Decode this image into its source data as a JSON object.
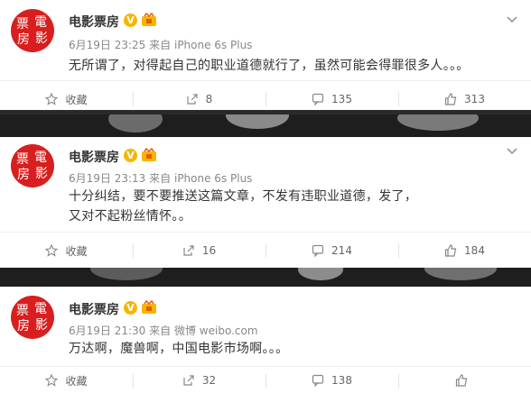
{
  "posts": [
    {
      "author": "电影票房",
      "avatar_chars": [
        "票",
        "電",
        "房",
        "影"
      ],
      "time": "6月19日 23:25",
      "source_prefix": "来自",
      "source": "iPhone 6s Plus",
      "content": "无所谓了，对得起自己的职业道德就行了，虽然可能会得罪很多人。。。",
      "actions": {
        "favorite": "收藏",
        "repost": "8",
        "comment": "135",
        "like": "313"
      }
    },
    {
      "author": "电影票房",
      "avatar_chars": [
        "票",
        "電",
        "房",
        "影"
      ],
      "time": "6月19日 23:13",
      "source_prefix": "来自",
      "source": "iPhone 6s Plus",
      "content": "十分纠结，要不要推送这篇文章，不发有违职业道德，发了，又对不起粉丝情怀。。",
      "actions": {
        "favorite": "收藏",
        "repost": "16",
        "comment": "214",
        "like": "184"
      }
    },
    {
      "author": "电影票房",
      "avatar_chars": [
        "票",
        "電",
        "房",
        "影"
      ],
      "time": "6月19日 21:30",
      "source_prefix": "来自",
      "source": "微博 weibo.com",
      "content": "万达啊，魔兽啊，中国电影市场啊。。。",
      "actions": {
        "favorite": "收藏",
        "repost": "32",
        "comment": "138",
        "like": ""
      }
    }
  ],
  "colors": {
    "verified": "#f7b500",
    "avatar_bg": "#d81e1e",
    "text": "#333333",
    "meta": "#888888"
  }
}
